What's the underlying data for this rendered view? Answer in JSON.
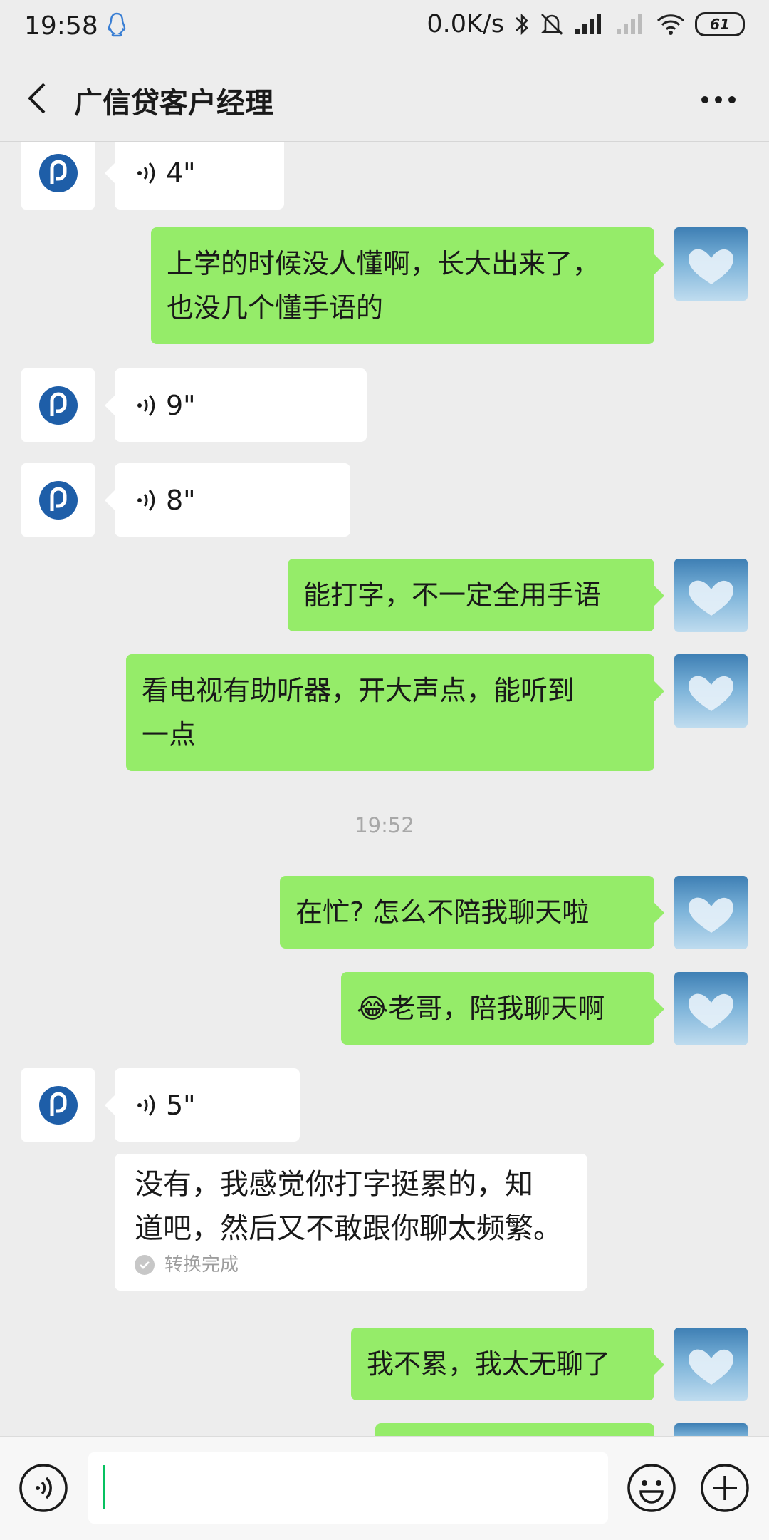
{
  "status_bar": {
    "time": "19:58",
    "network_speed": "0.0K/s",
    "battery": "61"
  },
  "header": {
    "title": "广信贷客户经理"
  },
  "messages": {
    "m1_duration": "4\"",
    "m2_text_line1": "上学的时候没人懂啊，长大出来了，",
    "m2_text_line2": "也没几个懂手语的",
    "m3_duration": "9\"",
    "m4_duration": "8\"",
    "m5_text": "能打字，不一定全用手语",
    "m6_text_line1": "看电视有助听器，开大声点，能听到",
    "m6_text_line2": "一点",
    "time_separator": "19:52",
    "m7_text": "在忙? 怎么不陪我聊天啦",
    "m8_emoji": "😂",
    "m8_text": "老哥，陪我聊天啊",
    "m9_duration": "5\"",
    "m10_transcript_line1": "没有，我感觉你打字挺累的，知",
    "m10_transcript_line2": "道吧，然后又不敢跟你聊太频繁。",
    "m10_status": "转换完成",
    "m11_text": "我不累，我太无聊了"
  },
  "input": {
    "value": ""
  },
  "colors": {
    "background": "#ededed",
    "sent_bubble": "#95ec69",
    "received_bubble": "#ffffff",
    "caret": "#07c160",
    "avatar_logo": "#1e5ea8"
  },
  "icons": {
    "back": "chevron-left-icon",
    "more": "more-dots-icon",
    "voice_mode": "voice-icon",
    "emoji": "emoji-smile-icon",
    "plus": "plus-circle-icon"
  }
}
